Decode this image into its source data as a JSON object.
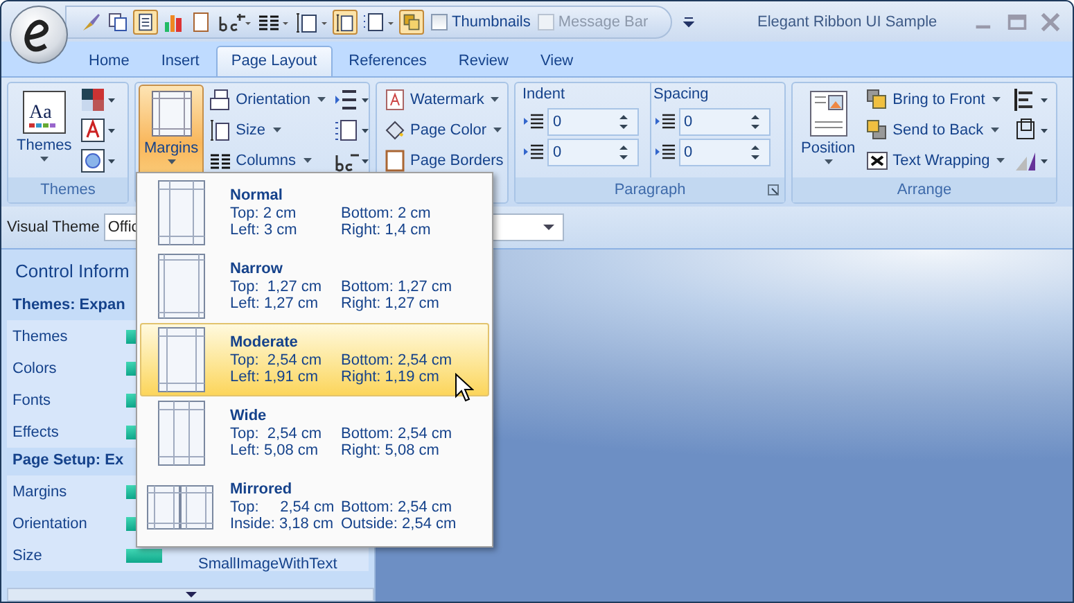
{
  "window": {
    "title": "Elegant Ribbon UI Sample"
  },
  "quick_access": {
    "checkboxes": [
      {
        "label": "Thumbnails",
        "checked": false,
        "disabled": false
      },
      {
        "label": "Message Bar",
        "checked": false,
        "disabled": true
      }
    ]
  },
  "tabs": [
    {
      "label": "Home",
      "selected": false
    },
    {
      "label": "Insert",
      "selected": false
    },
    {
      "label": "Page Layout",
      "selected": true
    },
    {
      "label": "References",
      "selected": false
    },
    {
      "label": "Review",
      "selected": false
    },
    {
      "label": "View",
      "selected": false
    }
  ],
  "ribbon": {
    "themes": {
      "label": "Themes",
      "button": "Themes",
      "icon_text": "Aa"
    },
    "page_setup": {
      "margins": "Margins",
      "orientation": "Orientation",
      "size": "Size",
      "columns": "Columns"
    },
    "page_background": {
      "watermark": "Watermark",
      "page_color": "Page Color",
      "page_borders": "Page Borders"
    },
    "paragraph": {
      "label": "Paragraph",
      "indent": {
        "label": "Indent",
        "values": [
          "0",
          "0"
        ]
      },
      "spacing": {
        "label": "Spacing",
        "values": [
          "0",
          "0"
        ]
      }
    },
    "arrange": {
      "label": "Arrange",
      "position": "Position",
      "bring_to_front": "Bring to Front",
      "send_to_back": "Send to Back",
      "text_wrapping": "Text Wrapping"
    }
  },
  "visual_theme": {
    "label": "Visual Theme",
    "value": "Offic"
  },
  "control_panel": {
    "title": "Control Inform",
    "sections": [
      {
        "title": "Themes: Expan",
        "rows": [
          {
            "name": "Themes"
          },
          {
            "name": "Colors"
          },
          {
            "name": "Fonts"
          },
          {
            "name": "Effects"
          }
        ]
      },
      {
        "title": "Page Setup: Ex",
        "rows": [
          {
            "name": "Margins"
          },
          {
            "name": "Orientation"
          },
          {
            "name": "Size",
            "value": "SmallImageWithText"
          }
        ]
      }
    ]
  },
  "margins_menu": {
    "items": [
      {
        "kind": "normal",
        "name": "Normal",
        "selected": false,
        "lines": [
          [
            "Top: 2 cm",
            "Bottom: 2 cm"
          ],
          [
            "Left: 3 cm",
            "Right: 1,4 cm"
          ]
        ]
      },
      {
        "kind": "narrow",
        "name": "Narrow",
        "selected": false,
        "lines": [
          [
            "Top:  1,27 cm",
            "Bottom: 1,27 cm"
          ],
          [
            "Left: 1,27 cm",
            "Right: 1,27 cm"
          ]
        ]
      },
      {
        "kind": "moderate",
        "name": "Moderate",
        "selected": true,
        "lines": [
          [
            "Top:  2,54 cm",
            "Bottom: 2,54 cm"
          ],
          [
            "Left: 1,91 cm",
            "Right: 1,19 cm"
          ]
        ]
      },
      {
        "kind": "wide",
        "name": "Wide",
        "selected": false,
        "lines": [
          [
            "Top:  2,54 cm",
            "Bottom: 2,54 cm"
          ],
          [
            "Left: 5,08 cm",
            "Right: 5,08 cm"
          ]
        ]
      },
      {
        "kind": "mirrored",
        "name": "Mirrored",
        "selected": false,
        "lines": [
          [
            "Top:     2,54 cm",
            "Bottom: 2,54 cm"
          ],
          [
            "Inside: 3,18 cm",
            "Outside: 2,54 cm"
          ]
        ]
      }
    ]
  }
}
